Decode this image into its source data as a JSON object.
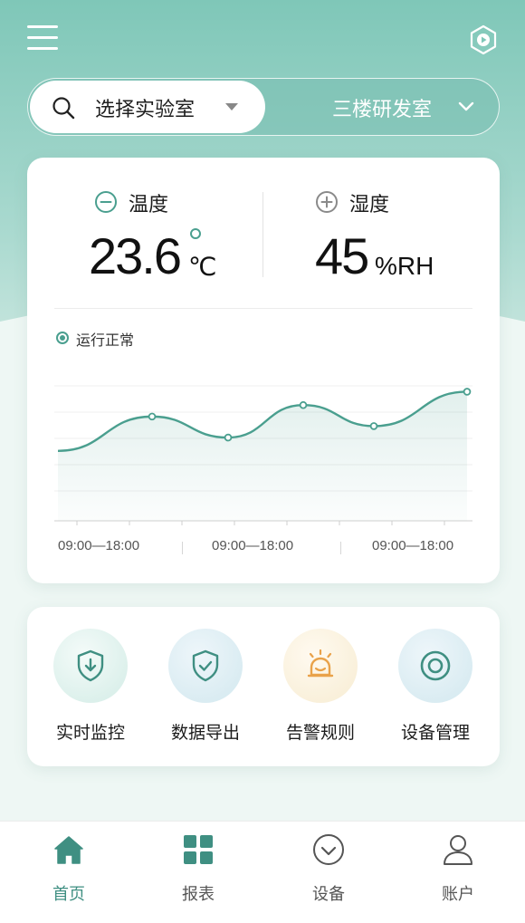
{
  "header": {
    "menu_icon": "hamburger-menu-icon",
    "action_icon": "hexagon-play-icon"
  },
  "selector": {
    "search_label": "选择实验室",
    "current_lab": "三楼研发室"
  },
  "metrics": {
    "temperature": {
      "label": "温度",
      "value": "23.6",
      "unit": "℃"
    },
    "humidity": {
      "label": "湿度",
      "value": "45",
      "unit": "%RH"
    },
    "status": "运行正常"
  },
  "chart_data": {
    "type": "line",
    "x": [
      0,
      1,
      2,
      3,
      4,
      5
    ],
    "values": [
      2.0,
      3.8,
      2.7,
      4.4,
      3.3,
      5.1
    ],
    "ylim": [
      0,
      6
    ],
    "grid": true,
    "tick_labels": [
      "09:00—18:00",
      "09:00—18:00",
      "09:00—18:00"
    ],
    "color": "#4a9f8f"
  },
  "features": [
    {
      "label": "实时监控",
      "icon": "shield-download-icon"
    },
    {
      "label": "数据导出",
      "icon": "shield-check-icon"
    },
    {
      "label": "告警规则",
      "icon": "alarm-bell-icon"
    },
    {
      "label": "设备管理",
      "icon": "target-ring-icon"
    }
  ],
  "tabs": [
    {
      "label": "首页",
      "icon": "home-icon"
    },
    {
      "label": "报表",
      "icon": "grid-icon"
    },
    {
      "label": "设备",
      "icon": "check-circle-icon"
    },
    {
      "label": "账户",
      "icon": "user-icon"
    }
  ],
  "colors": {
    "accent": "#4a9f8f",
    "header_bg": "#7fc7b8",
    "alarm": "#e9a24a"
  }
}
